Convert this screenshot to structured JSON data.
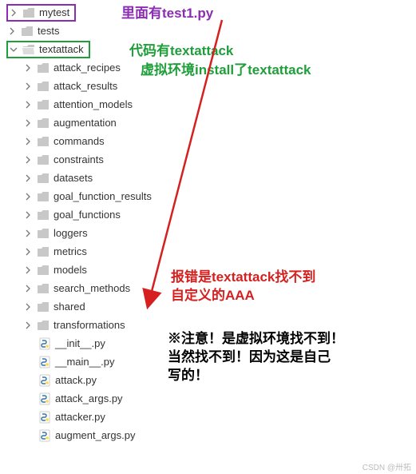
{
  "tree": {
    "mytest": "mytest",
    "tests": "tests",
    "textattack": "textattack",
    "children": [
      "attack_recipes",
      "attack_results",
      "attention_models",
      "augmentation",
      "commands",
      "constraints",
      "datasets",
      "goal_function_results",
      "goal_functions",
      "loggers",
      "metrics",
      "models",
      "search_methods",
      "shared",
      "transformations"
    ],
    "files": [
      "__init__.py",
      "__main__.py",
      "attack.py",
      "attack_args.py",
      "attacker.py",
      "augment_args.py"
    ]
  },
  "annotations": {
    "purple1": "里面有test1.py",
    "green1": "代码有textattack",
    "green2": "虚拟环境install了textattack",
    "red1": "报错是textattack找不到",
    "red2": "自定义的AAA",
    "black1": "※注意！是虚拟环境找不到！",
    "black2": "当然找不到！因为这是自己",
    "black3": "写的！"
  },
  "watermark": "CSDN @卅拓",
  "colors": {
    "purple": "#8b2db3",
    "green": "#1f9e3a",
    "red": "#d62020"
  }
}
